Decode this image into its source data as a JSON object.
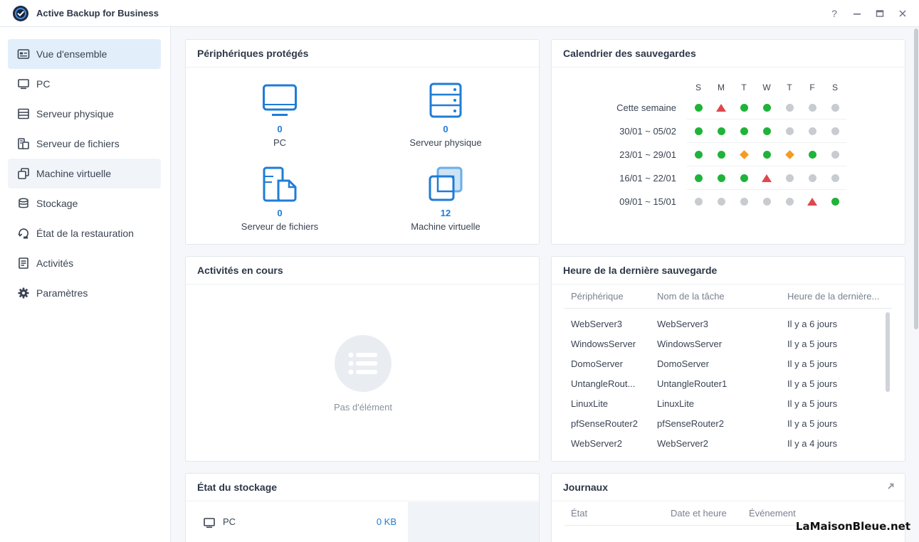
{
  "app": {
    "title": "Active Backup for Business"
  },
  "window": {
    "help": "?",
    "minimize": "—",
    "maximize": "▣",
    "close": "✕"
  },
  "sidebar": {
    "items": [
      {
        "label": "Vue d'ensemble",
        "icon": "overview-icon"
      },
      {
        "label": "PC",
        "icon": "pc-icon"
      },
      {
        "label": "Serveur physique",
        "icon": "server-icon"
      },
      {
        "label": "Serveur de fichiers",
        "icon": "file-server-icon"
      },
      {
        "label": "Machine virtuelle",
        "icon": "vm-icon"
      },
      {
        "label": "Stockage",
        "icon": "storage-icon"
      },
      {
        "label": "État de la restauration",
        "icon": "restore-icon"
      },
      {
        "label": "Activités",
        "icon": "activities-icon"
      },
      {
        "label": "Paramètres",
        "icon": "gear-icon"
      }
    ]
  },
  "protected": {
    "title": "Périphériques protégés",
    "pc": {
      "count": "0",
      "label": "PC"
    },
    "server": {
      "count": "0",
      "label": "Serveur physique"
    },
    "fileserver": {
      "count": "0",
      "label": "Serveur de fichiers"
    },
    "vm": {
      "count": "12",
      "label": "Machine virtuelle"
    }
  },
  "calendar": {
    "title": "Calendrier des sauvegardes",
    "days": [
      "S",
      "M",
      "T",
      "W",
      "T",
      "F",
      "S"
    ],
    "weeks": [
      {
        "label": "Cette semaine",
        "states": [
          "ok",
          "error",
          "ok",
          "ok",
          "none",
          "none",
          "none"
        ]
      },
      {
        "label": "30/01 ~ 05/02",
        "states": [
          "ok",
          "ok",
          "ok",
          "ok",
          "none",
          "none",
          "none"
        ]
      },
      {
        "label": "23/01 ~ 29/01",
        "states": [
          "ok",
          "ok",
          "warning",
          "ok",
          "warning",
          "ok",
          "none"
        ]
      },
      {
        "label": "16/01 ~ 22/01",
        "states": [
          "ok",
          "ok",
          "ok",
          "error",
          "none",
          "none",
          "none"
        ]
      },
      {
        "label": "09/01 ~ 15/01",
        "states": [
          "none",
          "none",
          "none",
          "none",
          "none",
          "error",
          "ok"
        ]
      }
    ],
    "colors": {
      "ok": "#20b33a",
      "none": "#c8cbd0",
      "error": "#e0474c",
      "warning": "#f59a23"
    }
  },
  "activities": {
    "title": "Activités en cours",
    "empty": "Pas d'élément"
  },
  "lastbackup": {
    "title": "Heure de la dernière sauvegarde",
    "columns": [
      "Périphérique",
      "Nom de la tâche",
      "Heure de la dernière..."
    ],
    "rows": [
      [
        "WebServer3",
        "WebServer3",
        "Il y a 6 jours"
      ],
      [
        "WindowsServer",
        "WindowsServer",
        "Il y a 5 jours"
      ],
      [
        "DomoServer",
        "DomoServer",
        "Il y a 5 jours"
      ],
      [
        "UntangleRout...",
        "UntangleRouter1",
        "Il y a 5 jours"
      ],
      [
        "LinuxLite",
        "LinuxLite",
        "Il y a 5 jours"
      ],
      [
        "pfSenseRouter2",
        "pfSenseRouter2",
        "Il y a 5 jours"
      ],
      [
        "WebServer2",
        "WebServer2",
        "Il y a 4 jours"
      ]
    ]
  },
  "storage": {
    "title": "État du stockage",
    "row_label": "PC",
    "row_value": "0 KB"
  },
  "logs": {
    "title": "Journaux",
    "columns": [
      "État",
      "Date et heure",
      "Événement"
    ]
  },
  "watermark": "LaMaisonBleue.net"
}
